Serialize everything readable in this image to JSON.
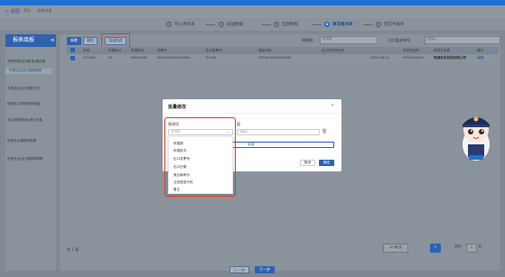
{
  "header": {
    "back_label": "← 返回",
    "breadcrumb": [
      "首页",
      "批量申报"
    ]
  },
  "steps": [
    {
      "num": "1",
      "label": "导入清单表",
      "active": false
    },
    {
      "num": "2",
      "label": "处理数据",
      "active": false
    },
    {
      "num": "3",
      "label": "匹配数据",
      "active": false
    },
    {
      "num": "4",
      "label": "填写报关单",
      "active": true
    },
    {
      "num": "5",
      "label": "提交申报单",
      "active": false
    }
  ],
  "sidebar": {
    "title": "报表填报",
    "menu_icon": "menu-icon",
    "items": [
      {
        "label": "货物贸易出口退(免)税申报",
        "selected": false
      },
      {
        "label": "外贸企业出口退税明细",
        "selected": true
      },
      {
        "label": "外贸企业出口退税汇总",
        "selected": false
      },
      {
        "label": "购进出口货物进货明细",
        "selected": false
      },
      {
        "label": "出口货物退(免)税汇总表",
        "selected": false
      },
      {
        "label": "外贸企业退税申报表",
        "selected": false
      },
      {
        "label": "外贸企业出口退税申报表",
        "selected": false
      }
    ]
  },
  "toolbar": {
    "add_label": "新增",
    "delete_label": "删除",
    "batch_edit_label": "批量修改"
  },
  "filters": {
    "declaration_label": "申报期:",
    "declaration_placeholder": "请选择",
    "export_no_label": "出口报关单号:",
    "export_no_placeholder": "请输入"
  },
  "table": {
    "headers": [
      "序号",
      "申报年月",
      "申报批次",
      "关联号",
      "出口发票号",
      "出口日期",
      "商品代码",
      "出口进货凭证号",
      "出口报关单号",
      "出口日期",
      "进货凭证号",
      "供货方名称",
      "操作"
    ],
    "rows": [
      [
        "1",
        "202306",
        "01",
        "08000000",
        "2023060000000001",
        "01544",
        "3204070000000000",
        "",
        "2023-06-11",
        "0000000000",
        "珠海某某贸易有限公司",
        "编辑"
      ]
    ]
  },
  "footer": {
    "total_label": "共 1 条",
    "page_size": "10 条/页",
    "current_page": "1",
    "goto_label": "前往",
    "goto_page": "1",
    "goto_suffix": "页"
  },
  "bottom": {
    "prev_label": "上一步",
    "next_label": "下一步"
  },
  "modal": {
    "title": "批量修改",
    "field_label": "修改项",
    "value_label": "值",
    "select_placeholder": "请选择",
    "input_placeholder": "请输入",
    "add_label": "新增",
    "cancel_label": "取消",
    "ok_label": "确定",
    "dropdown_items": [
      "所属期",
      "申报批次",
      "出口发票号",
      "出口日期",
      "美元离岸价",
      "业务类型代码",
      "备注"
    ]
  },
  "colors": {
    "accent": "#2f62b1",
    "highlight": "#e03a2a"
  }
}
